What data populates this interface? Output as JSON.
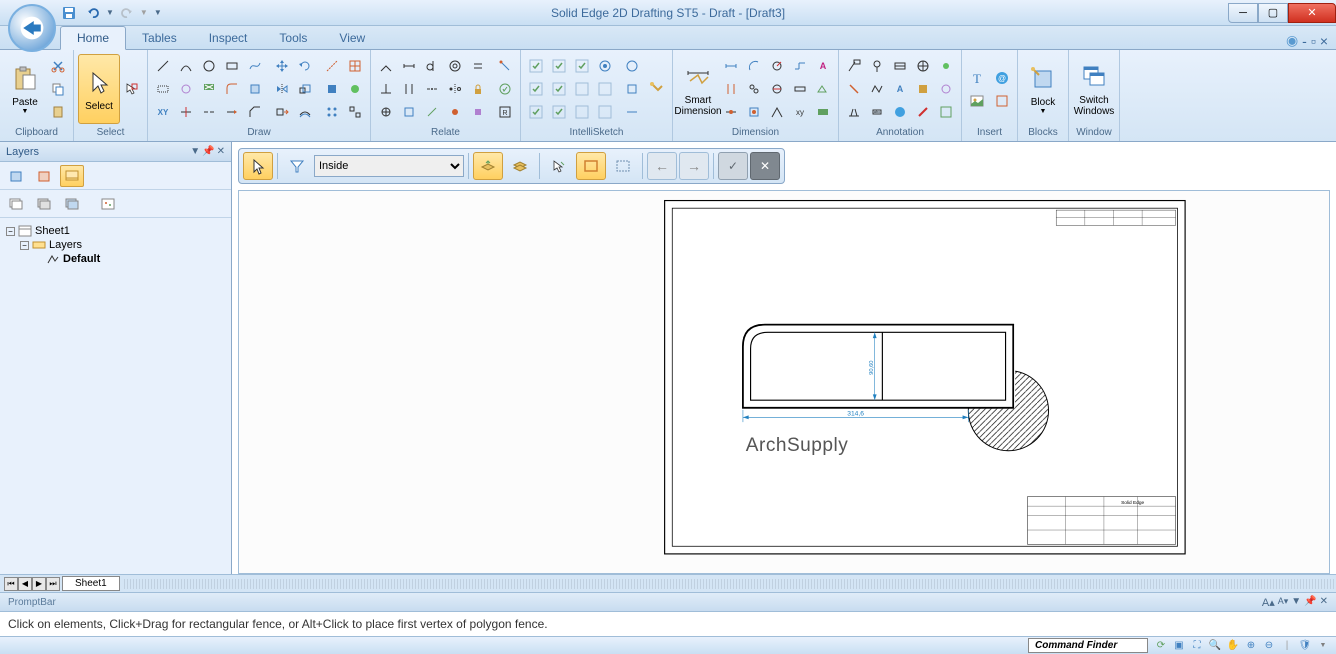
{
  "app": {
    "title": "Solid Edge 2D Drafting ST5 - Draft - [Draft3]"
  },
  "tabs": {
    "items": [
      "Home",
      "Tables",
      "Inspect",
      "Tools",
      "View"
    ],
    "active": 0
  },
  "ribbon": {
    "groups": {
      "clipboard": {
        "label": "Clipboard",
        "paste": "Paste"
      },
      "select": {
        "label": "Select",
        "select": "Select"
      },
      "draw": {
        "label": "Draw"
      },
      "relate": {
        "label": "Relate"
      },
      "intellisketch": {
        "label": "IntelliSketch"
      },
      "dimension": {
        "label": "Dimension",
        "smart": "Smart\nDimension"
      },
      "annotation": {
        "label": "Annotation"
      },
      "insert": {
        "label": "Insert"
      },
      "blocks": {
        "label": "Blocks",
        "block": "Block"
      },
      "window": {
        "label": "Window",
        "switch": "Switch\nWindows"
      }
    }
  },
  "layers": {
    "title": "Layers",
    "tree": {
      "sheet": "Sheet1",
      "layers_node": "Layers",
      "default_layer": "Default"
    }
  },
  "context_bar": {
    "filter_value": "Inside"
  },
  "drawing": {
    "watermark": "ArchSupply",
    "dim_h": "314,6",
    "dim_v": "90,60",
    "titleblock": "Solid Edge"
  },
  "sheet_tabs": {
    "active": "Sheet1"
  },
  "prompt": {
    "label": "PromptBar",
    "text": "Click on elements, Click+Drag for rectangular fence, or Alt+Click to place first vertex of polygon fence."
  },
  "status": {
    "command_finder": "Command Finder"
  }
}
